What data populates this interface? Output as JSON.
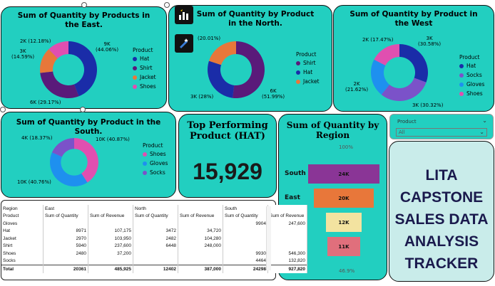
{
  "products_chart": {
    "title": "Sum of Quantity by Products in the East.",
    "legend_title": "Product",
    "legend": [
      {
        "name": "Hat",
        "color": "#1a2ca8"
      },
      {
        "name": "Shirt",
        "color": "#5a1a7a"
      },
      {
        "name": "Jacket",
        "color": "#e8773a"
      },
      {
        "name": "Shoes",
        "color": "#e04fb0"
      }
    ],
    "labels": {
      "a": "9K",
      "a2": "(44.06%)",
      "b": "6K (29.17%)",
      "c": "3K",
      "c2": "(14.59%)",
      "d": "2K (12.18%)"
    }
  },
  "north_chart": {
    "title": "Sum of Quantity by Product in the North.",
    "legend_title": "Product",
    "legend": [
      {
        "name": "Shirt",
        "color": "#5a1a7a"
      },
      {
        "name": "Hat",
        "color": "#1a2ca8"
      },
      {
        "name": "Jacket",
        "color": "#e8773a"
      }
    ],
    "labels": {
      "a": "6K",
      "a2": "(51.99%)",
      "b": "3K (28%)",
      "c": "(20.01%)"
    }
  },
  "west_chart": {
    "title": "Sum of Quantity by Product in the West",
    "legend_title": "Product",
    "legend": [
      {
        "name": "Hat",
        "color": "#1a2ca8"
      },
      {
        "name": "Socks",
        "color": "#7b52c9"
      },
      {
        "name": "Gloves",
        "color": "#1e90ef"
      },
      {
        "name": "Shoes",
        "color": "#e04fb0"
      }
    ],
    "labels": {
      "a": "3K",
      "a2": "(30.58%)",
      "b": "3K (30.32%)",
      "c": "2K",
      "c2": "(21.62%)",
      "d": "2K (17.47%)"
    }
  },
  "south_chart": {
    "title": "Sum of Quantity by Product in the South.",
    "legend_title": "Product",
    "legend": [
      {
        "name": "Shoes",
        "color": "#e04fb0"
      },
      {
        "name": "Gloves",
        "color": "#1e90ef"
      },
      {
        "name": "Socks",
        "color": "#7b52c9"
      }
    ],
    "labels": {
      "a": "10K (40.87%)",
      "b": "10K (40.76%)",
      "c": "4K (18.37%)"
    }
  },
  "kpi": {
    "title": "Top Performing Product (HAT)",
    "value": "15,929"
  },
  "funnel": {
    "title": "Sum of Quantity by Region",
    "top_pct": "100%",
    "bottom_pct": "46.9%",
    "rows": [
      {
        "label": "South",
        "value": "24K",
        "color": "#8a3596"
      },
      {
        "label": "East",
        "value": "20K",
        "color": "#e8773a"
      },
      {
        "label": "North",
        "value": "12K",
        "color": "#f3e3a0"
      },
      {
        "label": "West",
        "value": "11K",
        "color": "#e06f7c"
      }
    ]
  },
  "slicer": {
    "label": "Product",
    "value": "All"
  },
  "tracker": {
    "line1": "LITA",
    "line2": "CAPSTONE",
    "line3": "SALES DATA",
    "line4": "ANALYSIS",
    "line5": "TRACKER"
  },
  "matrix": {
    "h1": [
      "Region",
      "East",
      "",
      "North",
      "",
      "South",
      ""
    ],
    "h2": [
      "Product",
      "Sum of Quantity",
      "Sum of Revenue",
      "Sum of Quantity",
      "Sum of Revenue",
      "Sum of Quantity",
      "Sum of Revenue"
    ],
    "rows": [
      [
        "Gloves",
        "",
        "",
        "",
        "",
        "9904",
        "247,600"
      ],
      [
        "Hat",
        "8971",
        "107,175",
        "3472",
        "34,720",
        "",
        ""
      ],
      [
        "Jacket",
        "2970",
        "103,950",
        "2482",
        "104,280",
        "",
        ""
      ],
      [
        "Shirt",
        "5940",
        "237,600",
        "6448",
        "248,000",
        "",
        ""
      ],
      [
        "Shoes",
        "2480",
        "37,200",
        "",
        "",
        "9930",
        "546,300"
      ],
      [
        "Socks",
        "",
        "",
        "",
        "",
        "4464",
        "132,820"
      ]
    ],
    "total": [
      "Total",
      "20361",
      "485,925",
      "12402",
      "387,000",
      "24298",
      "927,820"
    ]
  },
  "chart_data": [
    {
      "type": "pie",
      "title": "Sum of Quantity by Products in the East.",
      "categories": [
        "Hat",
        "Shirt",
        "Jacket",
        "Shoes"
      ],
      "values": [
        44.06,
        29.17,
        14.59,
        12.18
      ]
    },
    {
      "type": "pie",
      "title": "Sum of Quantity by Product in the North.",
      "categories": [
        "Shirt",
        "Hat",
        "Jacket"
      ],
      "values": [
        51.99,
        28,
        20.01
      ]
    },
    {
      "type": "pie",
      "title": "Sum of Quantity by Product in the West",
      "categories": [
        "Hat",
        "Socks",
        "Gloves",
        "Shoes"
      ],
      "values": [
        30.58,
        30.32,
        21.62,
        17.47
      ]
    },
    {
      "type": "pie",
      "title": "Sum of Quantity by Product in the South.",
      "categories": [
        "Shoes",
        "Gloves",
        "Socks"
      ],
      "values": [
        40.87,
        40.76,
        18.37
      ]
    },
    {
      "type": "bar",
      "title": "Sum of Quantity by Region",
      "categories": [
        "South",
        "East",
        "North",
        "West"
      ],
      "values": [
        24,
        20,
        12,
        11
      ]
    }
  ]
}
